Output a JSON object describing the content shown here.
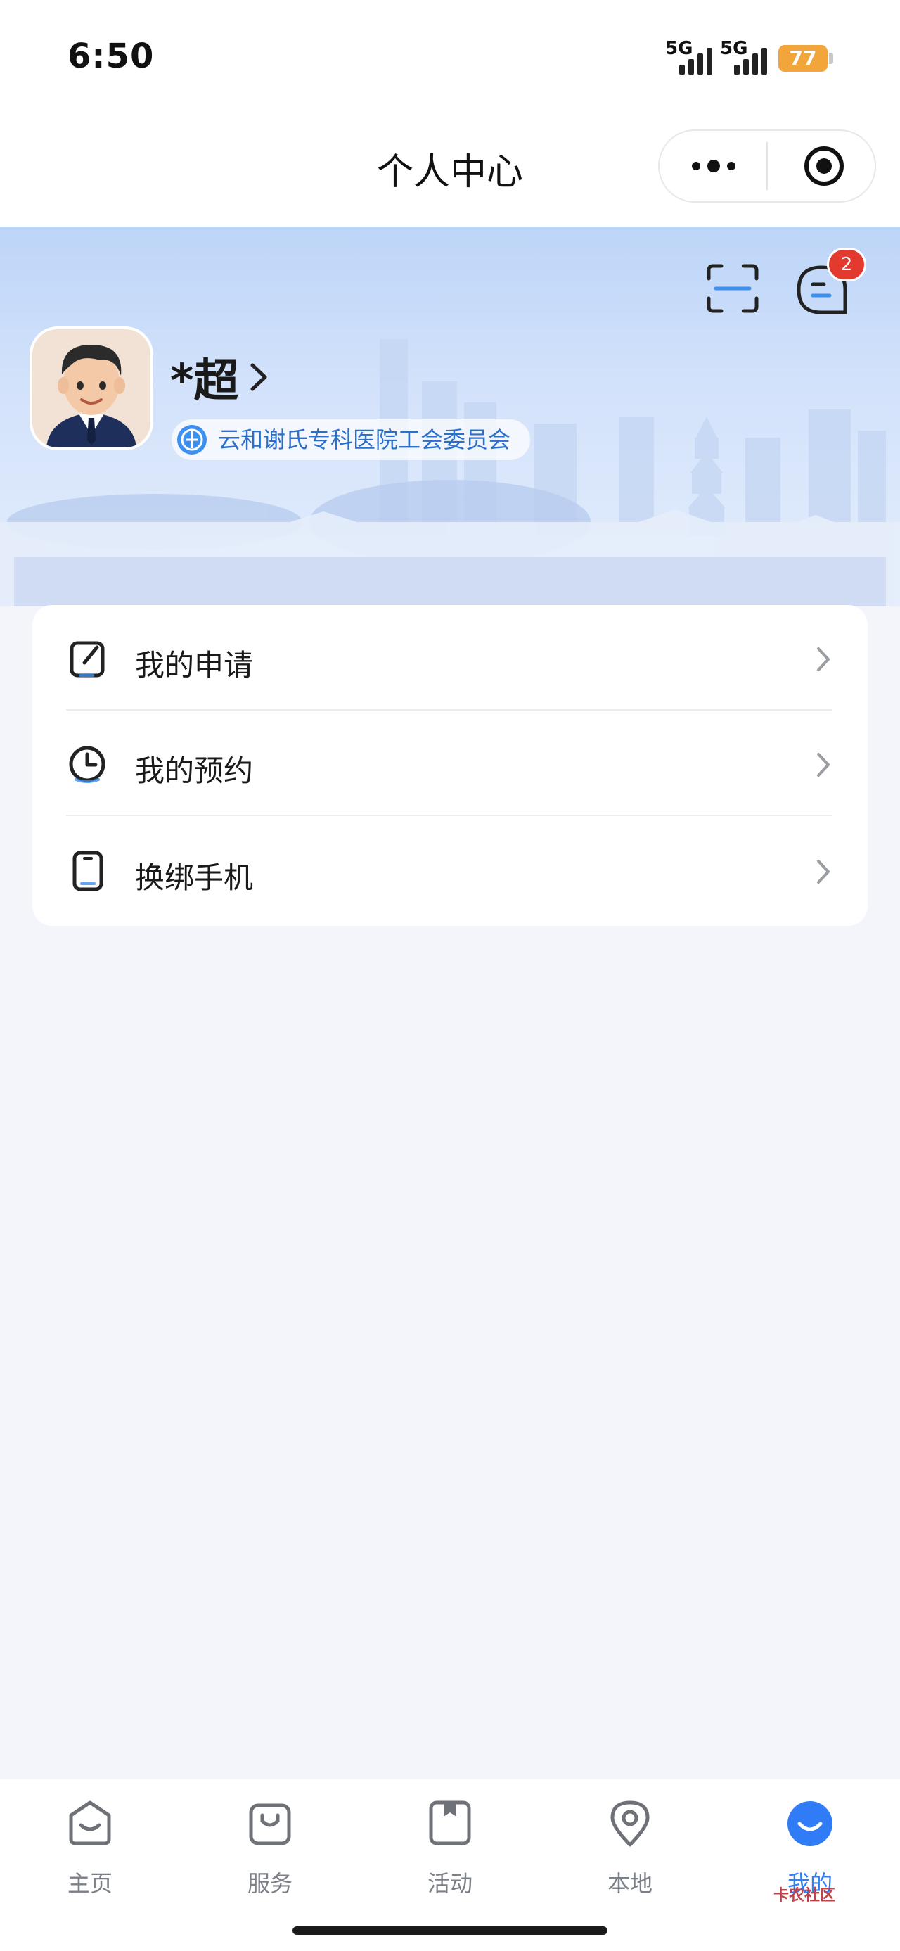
{
  "status_bar": {
    "time": "6:50",
    "network_1": "5G",
    "network_2": "5G",
    "battery": "77"
  },
  "nav": {
    "title": "个人中心"
  },
  "header": {
    "username": "*超",
    "organization": "云和谢氏专科医院工会委员会",
    "message_badge": "2"
  },
  "menu": [
    {
      "label": "我的申请",
      "icon": "edit-note-icon"
    },
    {
      "label": "我的预约",
      "icon": "clock-icon"
    },
    {
      "label": "换绑手机",
      "icon": "phone-icon"
    }
  ],
  "tabs": [
    {
      "label": "主页",
      "icon": "home-icon"
    },
    {
      "label": "服务",
      "icon": "bag-icon"
    },
    {
      "label": "活动",
      "icon": "bookmark-icon"
    },
    {
      "label": "本地",
      "icon": "location-icon"
    },
    {
      "label": "我的",
      "icon": "profile-icon",
      "active": true
    }
  ],
  "watermark": "卡农社区",
  "colors": {
    "accent": "#3d8ff0",
    "badge": "#e23a2e",
    "battery": "#f2a53a",
    "active_tab": "#2f7cf6"
  }
}
